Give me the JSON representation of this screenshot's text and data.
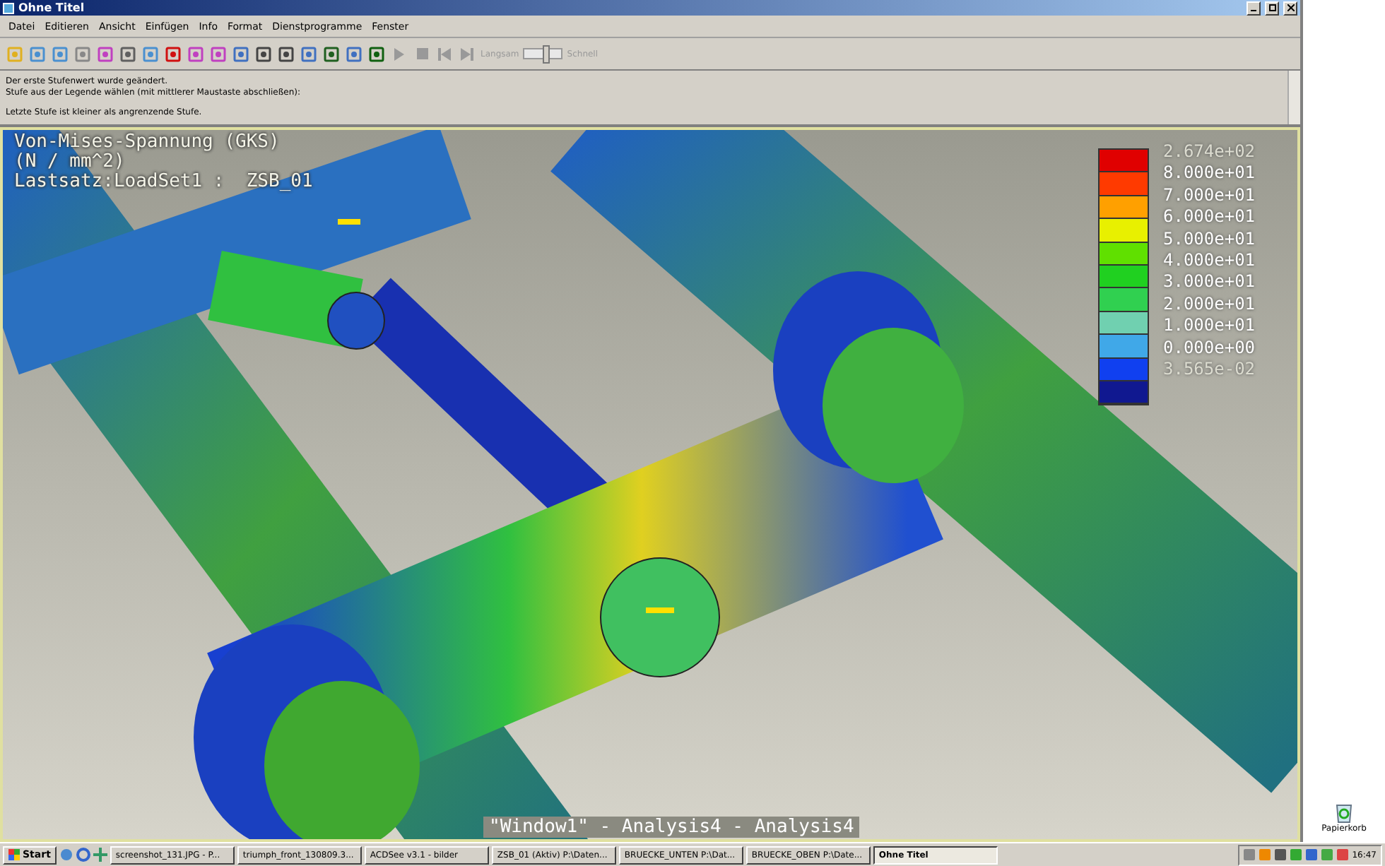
{
  "window": {
    "title": "Ohne Titel"
  },
  "menu": [
    "Datei",
    "Editieren",
    "Ansicht",
    "Einfügen",
    "Info",
    "Format",
    "Dienstprogramme",
    "Fenster"
  ],
  "toolbar": {
    "speed_slow": "Langsam",
    "speed_fast": "Schnell",
    "speed": {
      "level": 0.55
    }
  },
  "messages": [
    "Der erste Stufenwert wurde geändert.",
    "Stufe aus der Legende wählen (mit mittlerer Maustaste abschließen):",
    "Letzte Stufe ist kleiner als angrenzende Stufe."
  ],
  "viewport": {
    "title_lines": [
      "Von-Mises-Spannung (GKS)",
      "(N / mm^2)",
      "Lastsatz:LoadSet1 :  ZSB_01"
    ],
    "caption": "\"Window1\" - Analysis4 - Analysis4",
    "legend": {
      "labels": [
        {
          "text": "2.674e+02",
          "kind": "extreme"
        },
        {
          "text": "8.000e+01",
          "kind": "level"
        },
        {
          "text": "7.000e+01",
          "kind": "level"
        },
        {
          "text": "6.000e+01",
          "kind": "level"
        },
        {
          "text": "5.000e+01",
          "kind": "level"
        },
        {
          "text": "4.000e+01",
          "kind": "level"
        },
        {
          "text": "3.000e+01",
          "kind": "level"
        },
        {
          "text": "2.000e+01",
          "kind": "level"
        },
        {
          "text": "1.000e+01",
          "kind": "level"
        },
        {
          "text": "0.000e+00",
          "kind": "level"
        },
        {
          "text": "3.565e-02",
          "kind": "extreme"
        }
      ],
      "bands": [
        {
          "color": "#e00000"
        },
        {
          "color": "#ff3a00"
        },
        {
          "color": "#ffa000"
        },
        {
          "color": "#e8f000"
        },
        {
          "color": "#60e000"
        },
        {
          "color": "#20d020"
        },
        {
          "color": "#30d050"
        },
        {
          "color": "#70d0b0"
        },
        {
          "color": "#40a8e8"
        },
        {
          "color": "#1040f0"
        },
        {
          "color": "#101890"
        }
      ]
    }
  },
  "desktop": {
    "recycle_bin": "Papierkorb"
  },
  "taskbar": {
    "start": "Start",
    "items": [
      {
        "label": "screenshot_131.JPG - P...",
        "selected": false
      },
      {
        "label": "triumph_front_130809.3...",
        "selected": false
      },
      {
        "label": "ACDSee v3.1 - bilder",
        "selected": false
      },
      {
        "label": "ZSB_01 (Aktiv) P:\\Daten...",
        "selected": false
      },
      {
        "label": "BRUECKE_UNTEN P:\\Dat...",
        "selected": false
      },
      {
        "label": "BRUECKE_OBEN P:\\Date...",
        "selected": false
      },
      {
        "label": "Ohne Titel",
        "selected": true
      }
    ],
    "clock": "16:47"
  }
}
